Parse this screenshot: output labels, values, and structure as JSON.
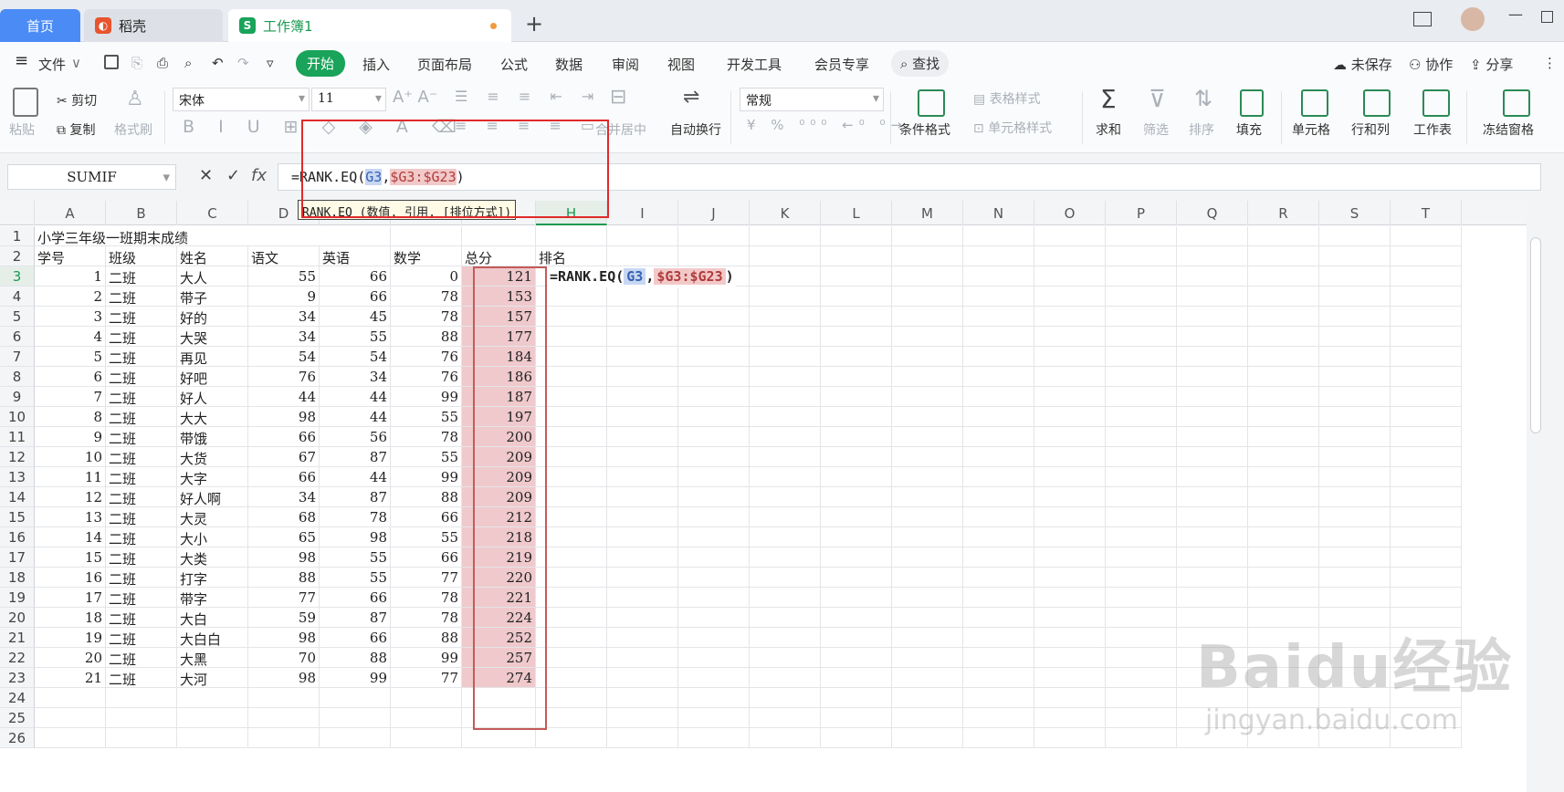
{
  "tabs": {
    "home": "首页",
    "docer": "稻壳",
    "book": "工作簿1",
    "new": "+"
  },
  "menu": {
    "hamburger": "≡",
    "file": "文件",
    "start": "开始",
    "insert": "插入",
    "layout": "页面布局",
    "formula": "公式",
    "data": "数据",
    "review": "审阅",
    "view": "视图",
    "dev": "开发工具",
    "vip": "会员专享",
    "search": "查找",
    "unsaved": "未保存",
    "collab": "协作",
    "share": "分享"
  },
  "ribbon": {
    "paste": "粘贴",
    "cut": "剪切",
    "copy": "复制",
    "format_painter": "格式刷",
    "font": "宋体",
    "size": "11",
    "merge": "合并居中",
    "wrap": "自动换行",
    "num_format": "常规",
    "cond_format": "条件格式",
    "table_style": "表格样式",
    "cell_style": "单元格样式",
    "sum": "求和",
    "filter": "筛选",
    "sort": "排序",
    "fill": "填充",
    "cell": "单元格",
    "rowcol": "行和列",
    "sheet": "工作表",
    "freeze": "冻结窗格"
  },
  "formula_bar": {
    "name_box": "SUMIF",
    "cancel": "✕",
    "accept": "✓",
    "fx": "fx",
    "prefix": "=RANK.EQ(",
    "ref1": "G3",
    ",": ",",
    "ref2": "$G3:$G23",
    "suffix": ")"
  },
  "tooltip": "RANK.EQ (数值, 引用, [排位方式])",
  "columns": [
    "A",
    "B",
    "C",
    "D",
    "E",
    "F",
    "G",
    "H",
    "I",
    "J",
    "K",
    "L",
    "M",
    "N",
    "O",
    "P",
    "Q",
    "R",
    "S",
    "T"
  ],
  "sheet": {
    "title": "小学三年级一班期末成绩",
    "headers": [
      "学号",
      "班级",
      "姓名",
      "语文",
      "英语",
      "数学",
      "总分",
      "排名"
    ],
    "rows": [
      [
        "1",
        "二班",
        "大人",
        "55",
        "66",
        "0",
        "121"
      ],
      [
        "2",
        "二班",
        "带子",
        "9",
        "66",
        "78",
        "153"
      ],
      [
        "3",
        "二班",
        "好的",
        "34",
        "45",
        "78",
        "157"
      ],
      [
        "4",
        "二班",
        "大哭",
        "34",
        "55",
        "88",
        "177"
      ],
      [
        "5",
        "二班",
        "再见",
        "54",
        "54",
        "76",
        "184"
      ],
      [
        "6",
        "二班",
        "好吧",
        "76",
        "34",
        "76",
        "186"
      ],
      [
        "7",
        "二班",
        "好人",
        "44",
        "44",
        "99",
        "187"
      ],
      [
        "8",
        "二班",
        "大大",
        "98",
        "44",
        "55",
        "197"
      ],
      [
        "9",
        "二班",
        "带饿",
        "66",
        "56",
        "78",
        "200"
      ],
      [
        "10",
        "二班",
        "大货",
        "67",
        "87",
        "55",
        "209"
      ],
      [
        "11",
        "二班",
        "大字",
        "66",
        "44",
        "99",
        "209"
      ],
      [
        "12",
        "二班",
        "好人啊",
        "34",
        "87",
        "88",
        "209"
      ],
      [
        "13",
        "二班",
        "大灵",
        "68",
        "78",
        "66",
        "212"
      ],
      [
        "14",
        "二班",
        "大小",
        "65",
        "98",
        "55",
        "218"
      ],
      [
        "15",
        "二班",
        "大类",
        "98",
        "55",
        "66",
        "219"
      ],
      [
        "16",
        "二班",
        "打字",
        "88",
        "55",
        "77",
        "220"
      ],
      [
        "17",
        "二班",
        "带字",
        "77",
        "66",
        "78",
        "221"
      ],
      [
        "18",
        "二班",
        "大白",
        "59",
        "87",
        "78",
        "224"
      ],
      [
        "19",
        "二班",
        "大白白",
        "98",
        "66",
        "88",
        "252"
      ],
      [
        "20",
        "二班",
        "大黑",
        "70",
        "88",
        "99",
        "257"
      ],
      [
        "21",
        "二班",
        "大河",
        "98",
        "99",
        "77",
        "274"
      ]
    ],
    "row_numbers": [
      "1",
      "2",
      "3",
      "4",
      "5",
      "6",
      "7",
      "8",
      "9",
      "10",
      "11",
      "12",
      "13",
      "14",
      "15",
      "16",
      "17",
      "18",
      "19",
      "20",
      "21",
      "22",
      "23",
      "24",
      "25",
      "26"
    ]
  },
  "edit_cell": {
    "prefix": "=RANK.EQ(",
    "ref1": "G3",
    "sep": ",",
    "ref2": "$G3:$G23",
    "suffix": ")"
  },
  "watermark": {
    "logo": "Baidu经验",
    "url": "jingyan.baidu.com"
  },
  "colors": {
    "accent": "#1aa35a",
    "tab_active": "#4b8bf5",
    "ref1_bg": "#c8d7f2",
    "ref2_bg": "#f2c9c9",
    "highlight": "#e02a2a"
  }
}
